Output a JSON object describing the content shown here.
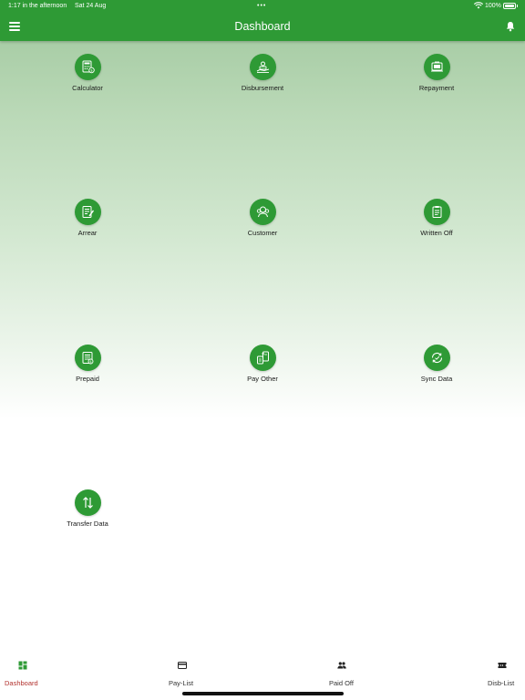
{
  "status": {
    "time": "1:17 in the afternoon",
    "date": "Sat 24 Aug",
    "dots": "•••",
    "battery": "100%"
  },
  "header": {
    "title": "Dashboard",
    "menu_icon": "hamburger-menu-icon",
    "bell_icon": "bell-icon"
  },
  "tiles": [
    {
      "label": "Calculator",
      "icon": "calculator-icon"
    },
    {
      "label": "Disbursement",
      "icon": "disbursement-icon"
    },
    {
      "label": "Repayment",
      "icon": "repayment-icon"
    },
    {
      "label": "Arrear",
      "icon": "arrear-icon"
    },
    {
      "label": "Customer",
      "icon": "customer-icon"
    },
    {
      "label": "Written Off",
      "icon": "written-off-icon"
    },
    {
      "label": "Prepaid",
      "icon": "prepaid-icon"
    },
    {
      "label": "Pay Other",
      "icon": "pay-other-icon"
    },
    {
      "label": "Sync Data",
      "icon": "sync-icon"
    },
    {
      "label": "Transfer Data",
      "icon": "transfer-icon"
    }
  ],
  "nav": [
    {
      "label": "Dashboard",
      "icon": "dashboard-icon",
      "active": true
    },
    {
      "label": "Pay-List",
      "icon": "card-icon",
      "active": false
    },
    {
      "label": "Paid Off",
      "icon": "people-icon",
      "active": false
    },
    {
      "label": "Disb-List",
      "icon": "ticket-icon",
      "active": false
    }
  ],
  "colors": {
    "primary": "#2e9a35",
    "active_nav": "#b2322e"
  }
}
